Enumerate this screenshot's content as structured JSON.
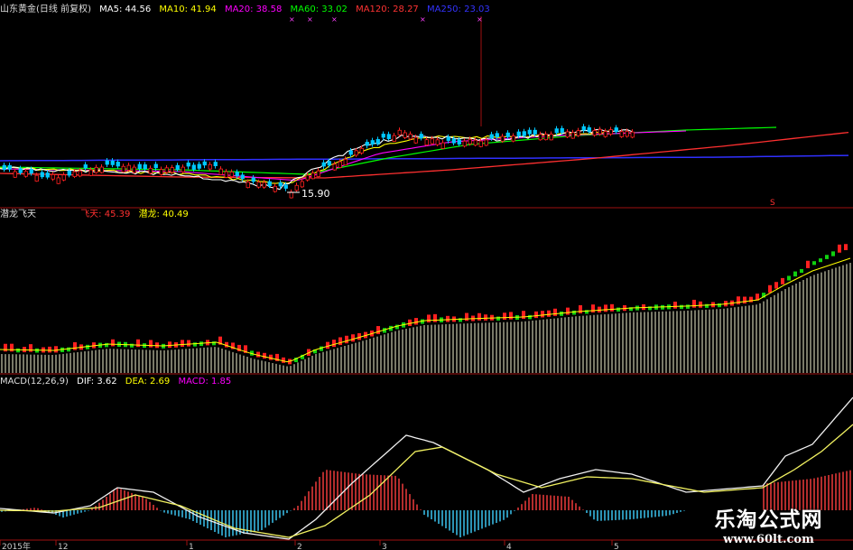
{
  "main_header": {
    "title": "山东黄金(日线 前复权)",
    "ma": [
      {
        "label": "MA5: 44.56",
        "color": "#ffffff"
      },
      {
        "label": "MA10: 41.94",
        "color": "#ffff00"
      },
      {
        "label": "MA20: 38.58",
        "color": "#ff00ff"
      },
      {
        "label": "MA60: 33.02",
        "color": "#00ff00"
      },
      {
        "label": "MA120: 28.27",
        "color": "#ff3333"
      },
      {
        "label": "MA250: 23.03",
        "color": "#3333ff"
      }
    ]
  },
  "main_chart": {
    "low_marker": "15.90",
    "top_right_marker": "S"
  },
  "indicator_header": {
    "name": "潜龙飞天",
    "feitian": "飞天: 45.39",
    "qianlong": "潜龙: 40.49"
  },
  "macd_header": {
    "name": "MACD(12,26,9)",
    "dif": "DIF: 3.62",
    "dea": "DEA: 2.69",
    "macd": "MACD: 1.85"
  },
  "x_axis": {
    "labels": [
      "2015年",
      "12",
      "1",
      "2",
      "3",
      "4",
      "5"
    ]
  },
  "watermark": {
    "title": "乐淘公式网",
    "url": "www.60lt.com"
  },
  "colors": {
    "up": "#ff2020",
    "down": "#00c0ff",
    "ma250": "#3030ff",
    "ma120": "#ff3030",
    "ma60": "#00ff00",
    "ma20": "#ff00ff",
    "ma10": "#ffff00",
    "ma5": "#ffffff"
  }
}
